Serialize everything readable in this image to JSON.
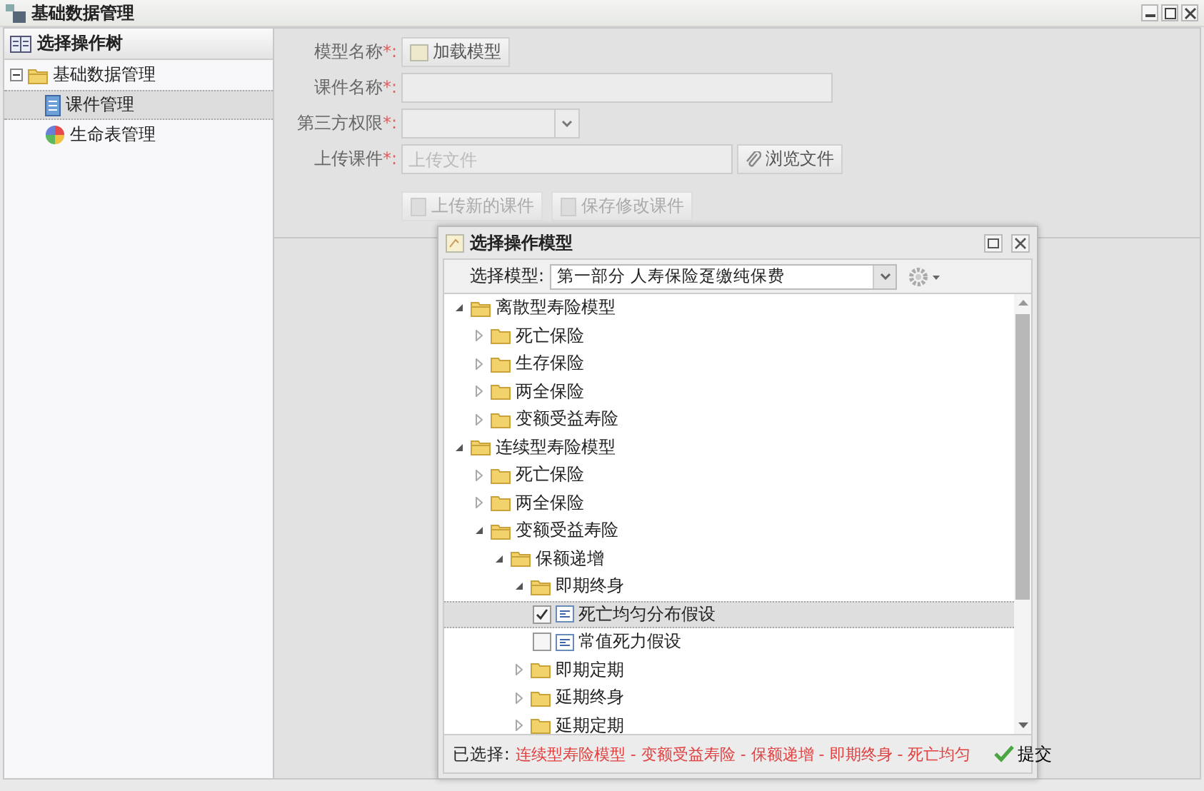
{
  "window": {
    "title": "基础数据管理"
  },
  "sidebar": {
    "title": "选择操作树",
    "items": [
      {
        "label": "基础数据管理",
        "kind": "folder",
        "expanded": true,
        "selected": false,
        "children": [
          {
            "label": "课件管理",
            "kind": "doc",
            "selected": true
          },
          {
            "label": "生命表管理",
            "kind": "wheel",
            "selected": false
          }
        ]
      }
    ]
  },
  "form": {
    "fields": [
      {
        "label": "模型名称",
        "required": "*:",
        "kind": "button",
        "button": "加载模型"
      },
      {
        "label": "课件名称",
        "required": "*:",
        "kind": "text"
      },
      {
        "label": "第三方权限",
        "required": "*:",
        "kind": "select"
      },
      {
        "label": "上传课件",
        "required": "*:",
        "kind": "file",
        "placeholder": "上传文件",
        "button": "浏览文件"
      }
    ],
    "actions": [
      {
        "label": "上传新的课件",
        "disabled": true
      },
      {
        "label": "保存修改课件",
        "disabled": true
      }
    ]
  },
  "dialog": {
    "title": "选择操作模型",
    "select_label": "选择模型:",
    "select_value": "第一部分 人寿保险趸缴纯保费",
    "tree": [
      {
        "label": "离散型寿险模型",
        "kind": "folder",
        "expanded": true,
        "selected": false,
        "children": [
          {
            "label": "死亡保险",
            "kind": "folder",
            "expanded": false,
            "selected": false
          },
          {
            "label": "生存保险",
            "kind": "folder",
            "expanded": false,
            "selected": false
          },
          {
            "label": "两全保险",
            "kind": "folder",
            "expanded": false,
            "selected": false
          },
          {
            "label": "变额受益寿险",
            "kind": "folder",
            "expanded": false,
            "selected": false
          }
        ]
      },
      {
        "label": "连续型寿险模型",
        "kind": "folder",
        "expanded": true,
        "selected": false,
        "children": [
          {
            "label": "死亡保险",
            "kind": "folder",
            "expanded": false,
            "selected": false
          },
          {
            "label": "两全保险",
            "kind": "folder",
            "expanded": false,
            "selected": false
          },
          {
            "label": "变额受益寿险",
            "kind": "folder",
            "expanded": true,
            "selected": false,
            "children": [
              {
                "label": "保额递增",
                "kind": "folder",
                "expanded": true,
                "selected": false,
                "children": [
                  {
                    "label": "即期终身",
                    "kind": "folder",
                    "expanded": true,
                    "selected": false,
                    "children": [
                      {
                        "label": "死亡均匀分布假设",
                        "kind": "leaf",
                        "checked": true,
                        "selected": true
                      },
                      {
                        "label": "常值死力假设",
                        "kind": "leaf",
                        "checked": false,
                        "selected": false
                      }
                    ]
                  },
                  {
                    "label": "即期定期",
                    "kind": "folder",
                    "expanded": false,
                    "selected": false
                  },
                  {
                    "label": "延期终身",
                    "kind": "folder",
                    "expanded": false,
                    "selected": false
                  },
                  {
                    "label": "延期定期",
                    "kind": "folder",
                    "expanded": false,
                    "selected": false
                  }
                ]
              }
            ]
          }
        ]
      }
    ],
    "footer_label": "已选择:",
    "footer_path": "连续型寿险模型 - 变额受益寿险 - 保额递增 - 即期终身 - 死亡均匀",
    "submit": "提交"
  }
}
